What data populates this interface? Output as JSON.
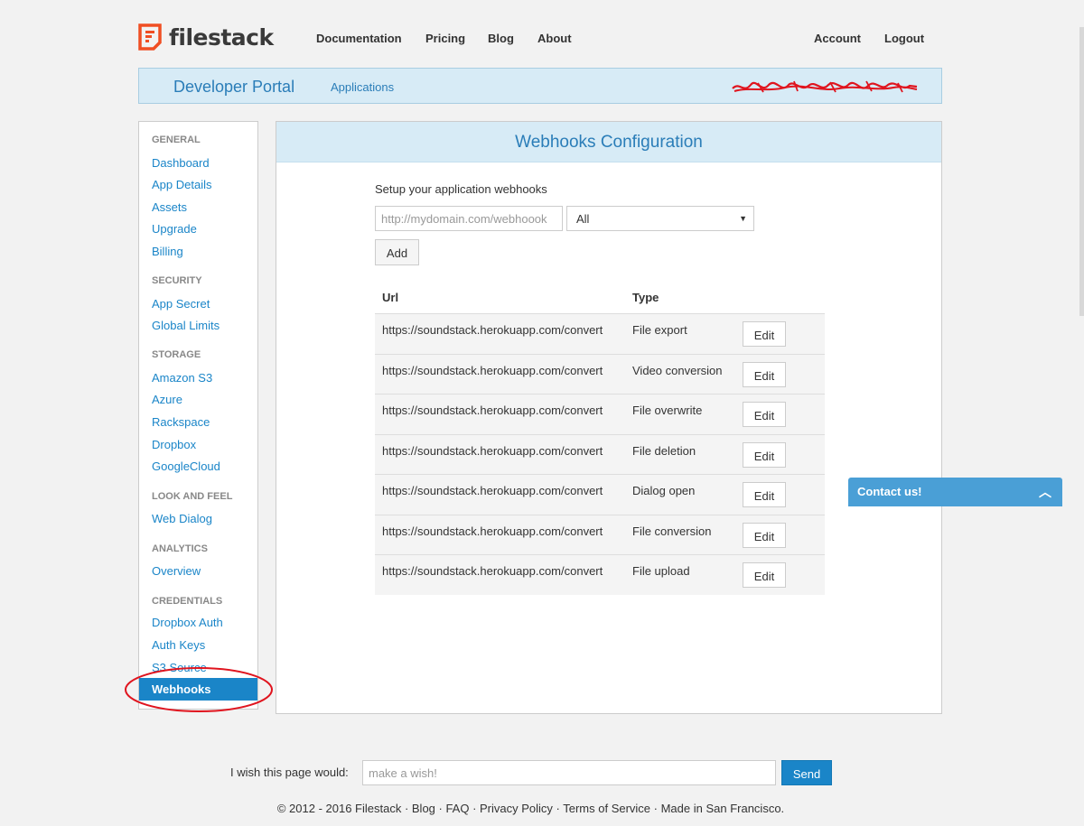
{
  "brand": {
    "name": "filestack",
    "accent": "#f04e23"
  },
  "nav": {
    "links": [
      "Documentation",
      "Pricing",
      "Blog",
      "About"
    ],
    "account": "Account",
    "logout": "Logout"
  },
  "portal": {
    "title": "Developer Portal",
    "applications": "Applications"
  },
  "sidebar": {
    "sections": [
      {
        "title": "GENERAL",
        "items": [
          "Dashboard",
          "App Details",
          "Assets",
          "Upgrade",
          "Billing"
        ]
      },
      {
        "title": "SECURITY",
        "items": [
          "App Secret",
          "Global Limits"
        ]
      },
      {
        "title": "STORAGE",
        "items": [
          "Amazon S3",
          "Azure",
          "Rackspace",
          "Dropbox",
          "GoogleCloud"
        ]
      },
      {
        "title": "LOOK AND FEEL",
        "items": [
          "Web Dialog"
        ]
      },
      {
        "title": "ANALYTICS",
        "items": [
          "Overview"
        ]
      },
      {
        "title": "CREDENTIALS",
        "items": [
          "Dropbox Auth",
          "Auth Keys",
          "S3 Source",
          "Webhooks"
        ]
      }
    ],
    "active": "Webhooks"
  },
  "main": {
    "title": "Webhooks Configuration",
    "setup_label": "Setup your application webhooks",
    "url_placeholder": "http://mydomain.com/webhoook",
    "type_selected": "All",
    "add_label": "Add",
    "columns": [
      "Url",
      "Type"
    ],
    "edit_label": "Edit",
    "rows": [
      {
        "url": "https://soundstack.herokuapp.com/convert",
        "type": "File export"
      },
      {
        "url": "https://soundstack.herokuapp.com/convert",
        "type": "Video conversion"
      },
      {
        "url": "https://soundstack.herokuapp.com/convert",
        "type": "File overwrite"
      },
      {
        "url": "https://soundstack.herokuapp.com/convert",
        "type": "File deletion"
      },
      {
        "url": "https://soundstack.herokuapp.com/convert",
        "type": "Dialog open"
      },
      {
        "url": "https://soundstack.herokuapp.com/convert",
        "type": "File conversion"
      },
      {
        "url": "https://soundstack.herokuapp.com/convert",
        "type": "File upload"
      }
    ]
  },
  "contact": {
    "label": "Contact us!"
  },
  "footer": {
    "wish_label": "I wish this page would:",
    "wish_placeholder": "make a wish!",
    "send_label": "Send",
    "copyright": "© 2012 - 2016 Filestack · Blog · FAQ · Privacy Policy · Terms of Service · Made in San Francisco."
  },
  "colors": {
    "link": "#1a85c8",
    "header_bg": "#d7ebf6",
    "annotation": "#e0141e"
  }
}
